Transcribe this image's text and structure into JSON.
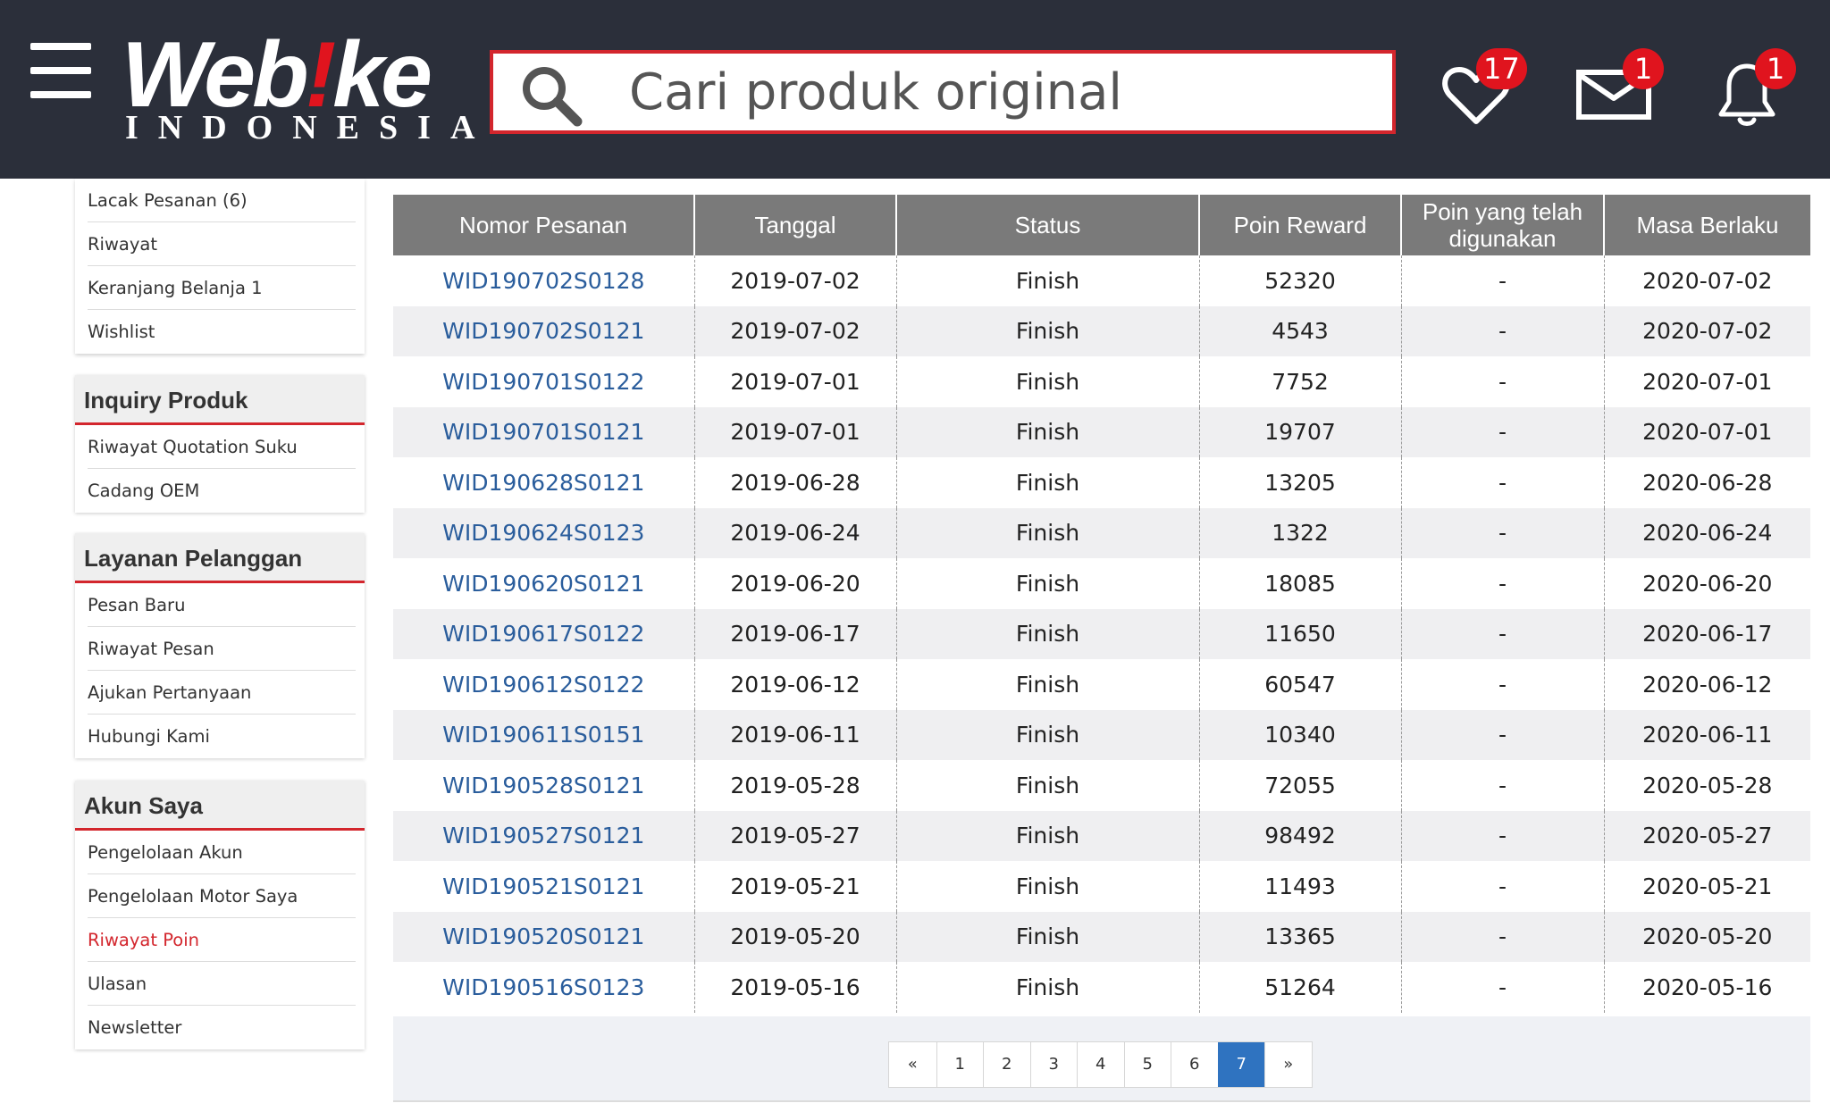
{
  "header": {
    "logo_main_a": "Web",
    "logo_main_bang": "!",
    "logo_main_b": "ke",
    "logo_sub": "INDONESIA",
    "search_placeholder": "Cari produk original",
    "wishlist_count": "17",
    "messages_count": "1",
    "notifications_count": "1",
    "accent_color": "#d3262d",
    "background_color": "#2b2f3a"
  },
  "sidebar": {
    "top_items": [
      "Lacak Pesanan (6)",
      "Riwayat",
      "Keranjang Belanja 1",
      "Wishlist"
    ],
    "sections": [
      {
        "title": "Inquiry Produk",
        "items": [
          "Riwayat Quotation Suku",
          "Cadang OEM"
        ]
      },
      {
        "title": "Layanan Pelanggan",
        "items": [
          "Pesan Baru",
          "Riwayat Pesan",
          "Ajukan Pertanyaan",
          "Hubungi Kami"
        ]
      },
      {
        "title": "Akun Saya",
        "items": [
          "Pengelolaan Akun",
          "Pengelolaan Motor Saya",
          "Riwayat Poin",
          "Ulasan",
          "Newsletter"
        ],
        "active": "Riwayat Poin"
      }
    ]
  },
  "table": {
    "headers": {
      "order": "Nomor Pesanan",
      "date": "Tanggal",
      "status": "Status",
      "points": "Poin Reward",
      "used_line1": "Poin yang telah",
      "used_line2": "digunakan",
      "expiry": "Masa Berlaku"
    },
    "rows": [
      [
        "WID190702S0128",
        "2019-07-02",
        "Finish",
        "52320",
        "-",
        "2020-07-02"
      ],
      [
        "WID190702S0121",
        "2019-07-02",
        "Finish",
        "4543",
        "-",
        "2020-07-02"
      ],
      [
        "WID190701S0122",
        "2019-07-01",
        "Finish",
        "7752",
        "-",
        "2020-07-01"
      ],
      [
        "WID190701S0121",
        "2019-07-01",
        "Finish",
        "19707",
        "-",
        "2020-07-01"
      ],
      [
        "WID190628S0121",
        "2019-06-28",
        "Finish",
        "13205",
        "-",
        "2020-06-28"
      ],
      [
        "WID190624S0123",
        "2019-06-24",
        "Finish",
        "1322",
        "-",
        "2020-06-24"
      ],
      [
        "WID190620S0121",
        "2019-06-20",
        "Finish",
        "18085",
        "-",
        "2020-06-20"
      ],
      [
        "WID190617S0122",
        "2019-06-17",
        "Finish",
        "11650",
        "-",
        "2020-06-17"
      ],
      [
        "WID190612S0122",
        "2019-06-12",
        "Finish",
        "60547",
        "-",
        "2020-06-12"
      ],
      [
        "WID190611S0151",
        "2019-06-11",
        "Finish",
        "10340",
        "-",
        "2020-06-11"
      ],
      [
        "WID190528S0121",
        "2019-05-28",
        "Finish",
        "72055",
        "-",
        "2020-05-28"
      ],
      [
        "WID190527S0121",
        "2019-05-27",
        "Finish",
        "98492",
        "-",
        "2020-05-27"
      ],
      [
        "WID190521S0121",
        "2019-05-21",
        "Finish",
        "11493",
        "-",
        "2020-05-21"
      ],
      [
        "WID190520S0121",
        "2019-05-20",
        "Finish",
        "13365",
        "-",
        "2020-05-20"
      ],
      [
        "WID190516S0123",
        "2019-05-16",
        "Finish",
        "51264",
        "-",
        "2020-05-16"
      ]
    ]
  },
  "pagination": {
    "prev": "«",
    "pages": [
      "1",
      "2",
      "3",
      "4",
      "5",
      "6",
      "7"
    ],
    "current": "7",
    "next": "»",
    "active_color": "#2f73c0"
  }
}
